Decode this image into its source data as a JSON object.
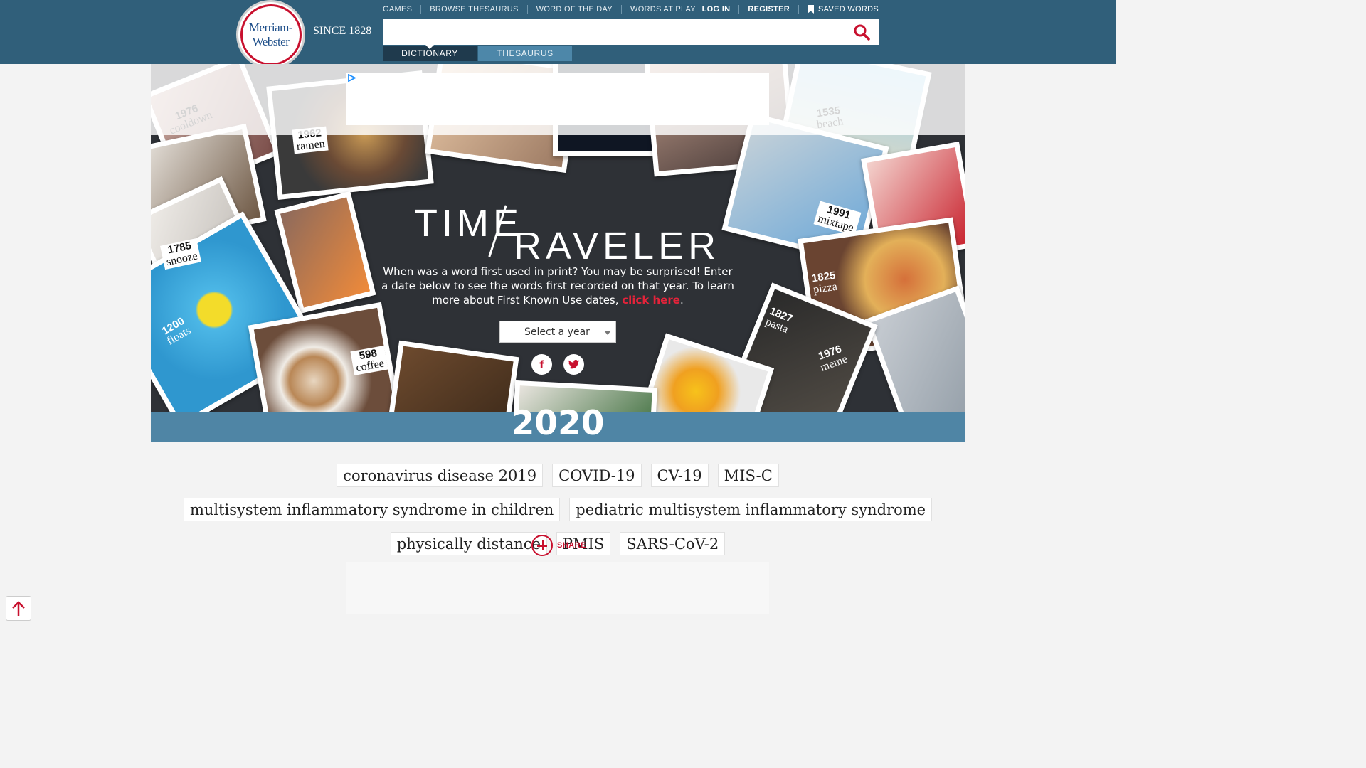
{
  "brand": {
    "logo_line1": "Merriam-",
    "logo_line2": "Webster",
    "since": "SINCE 1828",
    "color": "#305f7a",
    "accent": "#c8102e"
  },
  "nav": {
    "items": [
      "GAMES",
      "BROWSE THESAURUS",
      "WORD OF THE DAY",
      "WORDS AT PLAY"
    ],
    "login": "LOG IN",
    "register": "REGISTER",
    "saved": "SAVED WORDS"
  },
  "search": {
    "value": "",
    "placeholder": "",
    "icon": "search-icon"
  },
  "tabs": {
    "dictionary": "DICTIONARY",
    "thesaurus": "THESAURUS",
    "active": "DICTIONARY"
  },
  "hero": {
    "title_time": "TIME",
    "title_traveler": "RAVELER",
    "description": "When was a word first used in print? You may be surprised! Enter a date below to see the words first recorded on that year. To learn more about First Known Use dates,",
    "link_text": "click here",
    "link_suffix": ".",
    "select_label": "Select a year",
    "facebook_icon": "f",
    "twitter_icon": "t",
    "captions": [
      {
        "year": "1976",
        "word": "cooldown"
      },
      {
        "year": "1962",
        "word": "ramen"
      },
      {
        "year": "1535",
        "word": "beach"
      },
      {
        "year": "1991",
        "word": "mixtape"
      },
      {
        "year": "1785",
        "word": "snooze"
      },
      {
        "year": "1200",
        "word": "floats"
      },
      {
        "year": "598",
        "word": "coffee"
      },
      {
        "year": "1825",
        "word": "pizza"
      },
      {
        "year": "1827",
        "word": "pasta"
      },
      {
        "year": "1976",
        "word": "meme"
      }
    ]
  },
  "year": "2020",
  "words": [
    "coronavirus disease 2019",
    "COVID-19",
    "CV-19",
    "MIS-C",
    "multisystem inflammatory syndrome in children",
    "pediatric multisystem inflammatory syndrome",
    "physically distance",
    "PMIS",
    "SARS-CoV-2"
  ],
  "share_label": "SHARE"
}
